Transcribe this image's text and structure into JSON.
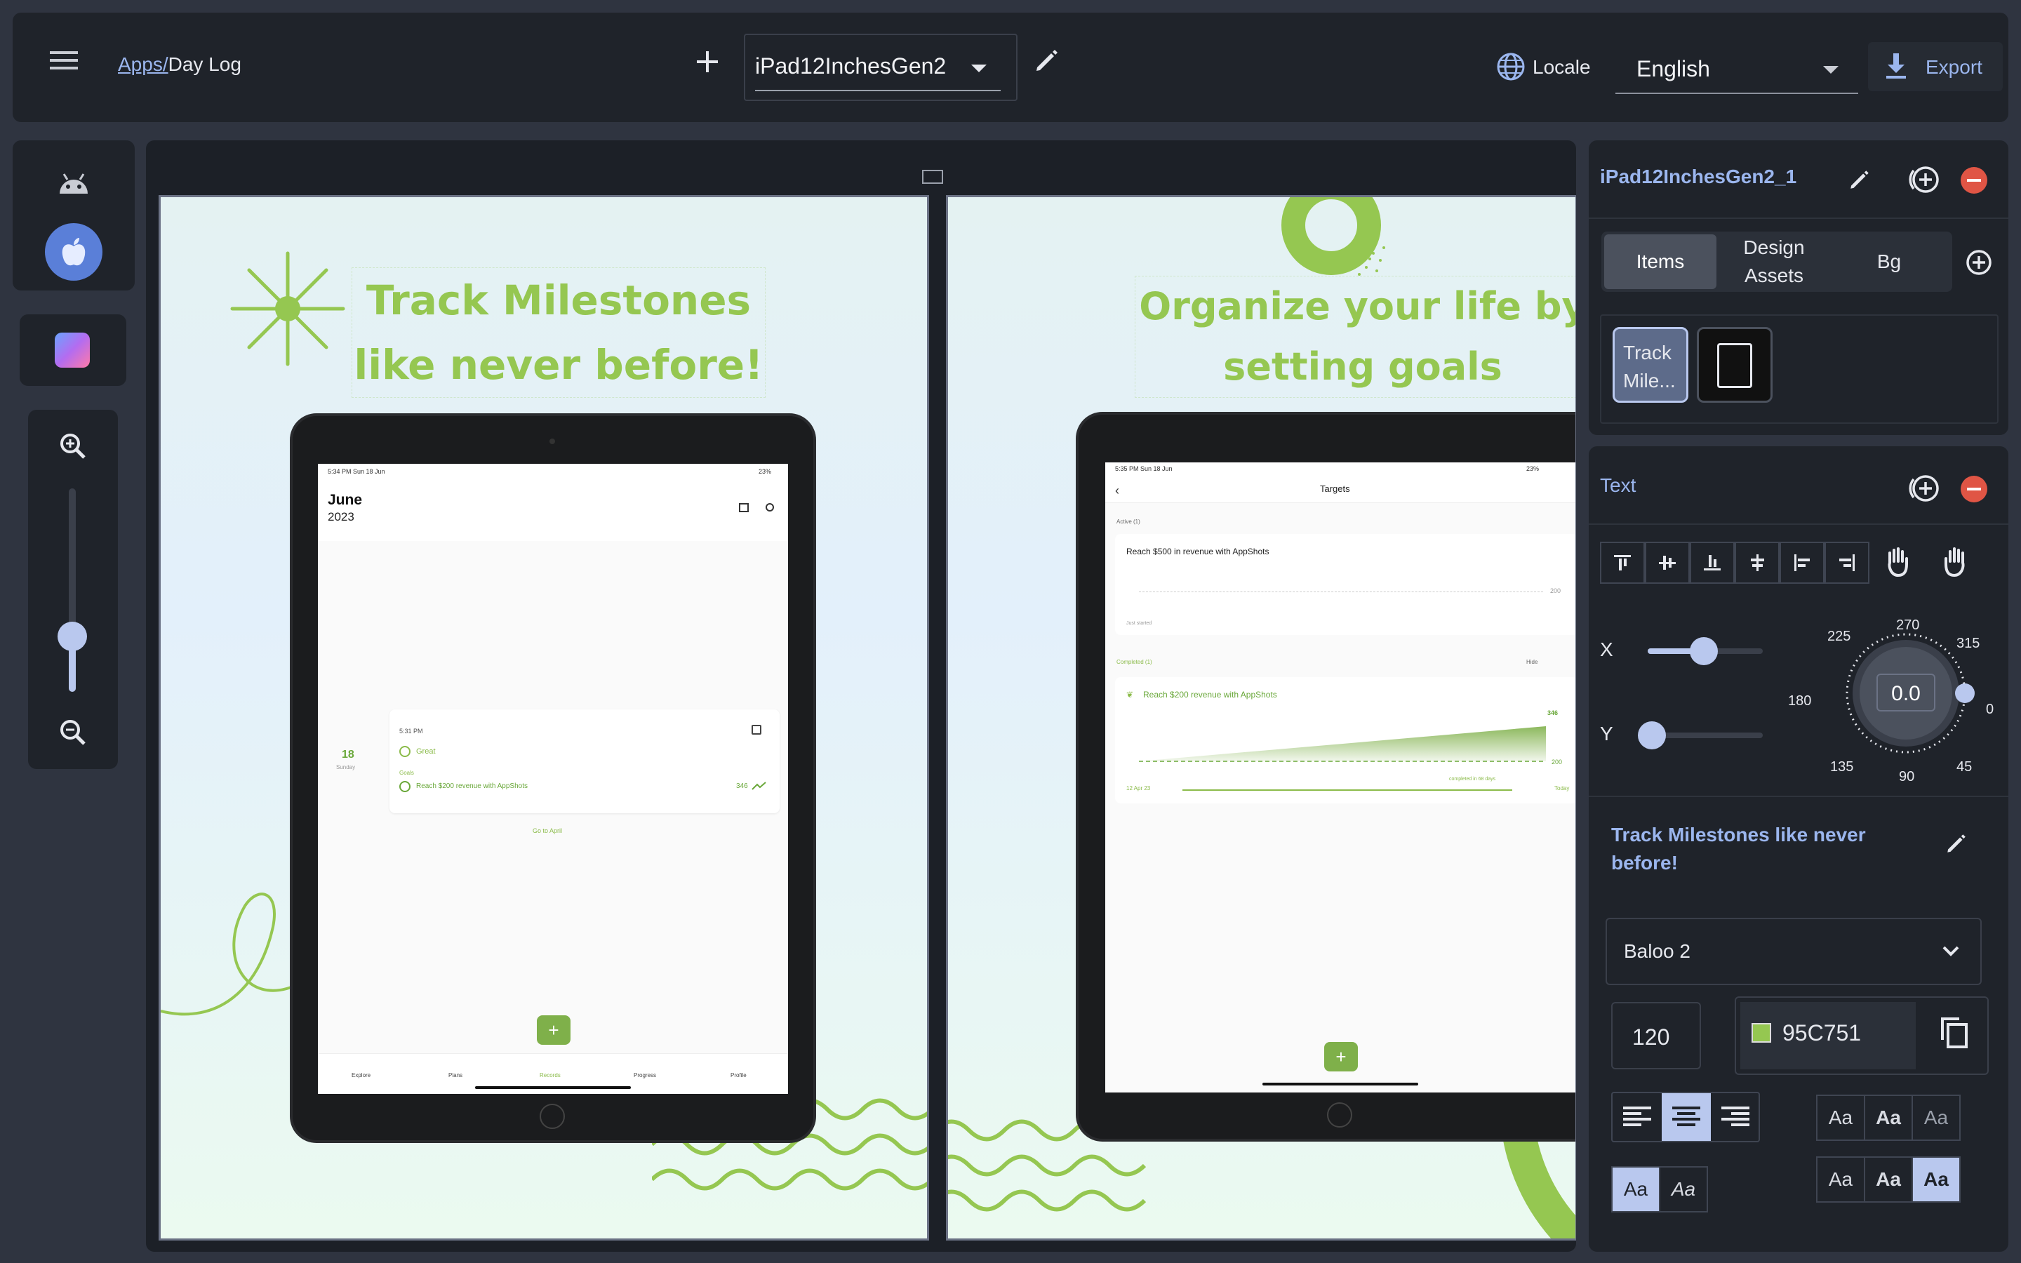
{
  "topbar": {
    "breadcrumb_link": "Apps/",
    "breadcrumb_current": "Day Log",
    "device_select": "iPad12InchesGen2",
    "locale_label": "Locale",
    "locale_value": "English",
    "export_label": "Export"
  },
  "canvas": {
    "left_panel": {
      "headline_line1": "Track Milestones",
      "headline_line2": "like never before!",
      "status_time": "5:34 PM  Sun 18 Jun",
      "status_right": "23%",
      "month": "June",
      "year": "2023",
      "entry_time": "5:31 PM",
      "entry_mood": "Great",
      "entry_goals_label": "Goals",
      "entry_goal": "Reach $200 revenue with AppShots",
      "entry_goal_value": "346",
      "day_number": "18",
      "day_name": "Sunday",
      "go_to": "Go to April",
      "tabs": [
        "Explore",
        "Plans",
        "Records",
        "Progress",
        "Profile"
      ]
    },
    "right_panel": {
      "headline_line1": "Organize your life by",
      "headline_line2": "setting goals",
      "status_time": "5:35 PM  Sun 18 Jun",
      "status_right": "23%",
      "nav_title": "Targets",
      "active_label": "Active (1)",
      "active_goal": "Reach $500 in revenue with AppShots",
      "active_value": "200",
      "active_status": "Just started",
      "completed_label": "Completed (1)",
      "hide_label": "Hide",
      "completed_goal": "Reach $200 revenue with AppShots",
      "completed_top": "346",
      "completed_base": "200",
      "date_start": "12 Apr 23",
      "date_note": "completed in 68 days",
      "date_end": "Today"
    }
  },
  "sidebar": {
    "screen_title": "iPad12InchesGen2_1",
    "tabs": [
      "Items",
      "Design\nAssets",
      "Bg"
    ],
    "item_label": "Track\nMile...",
    "text_section": "Text",
    "x_label": "X",
    "y_label": "Y",
    "rotation_value": "0.0",
    "dial_labels": [
      "270",
      "315",
      "0",
      "45",
      "90",
      "135",
      "180",
      "225"
    ],
    "text_content": "Track Milestones like never before!",
    "font_family": "Baloo 2",
    "font_size": "120",
    "color_hex": "95C751",
    "aa_labels": [
      "Aa",
      "Aa",
      "Aa",
      "Aa",
      "Aa",
      "Aa",
      "Aa",
      "Aa"
    ]
  },
  "colors": {
    "accent_green": "#95C751",
    "app_bg": "#2f3440",
    "panel_bg": "#1f232a",
    "active_blue": "#b9c8ee"
  }
}
